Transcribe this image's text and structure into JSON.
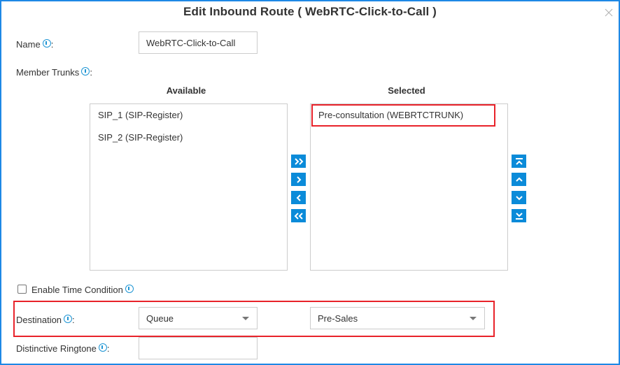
{
  "dialog": {
    "title": "Edit Inbound Route ( WebRTC-Click-to-Call )",
    "close_icon": "close-icon"
  },
  "form": {
    "name": {
      "label": "Name",
      "suffix": ":",
      "value": "WebRTC-Click-to-Call"
    },
    "member_trunks": {
      "label": "Member Trunks",
      "suffix": ":",
      "available_heading": "Available",
      "selected_heading": "Selected",
      "available": [
        "SIP_1 (SIP-Register)",
        "SIP_2 (SIP-Register)"
      ],
      "selected": [
        "Pre-consultation (WEBRTCTRUNK)"
      ],
      "transfer_buttons": [
        {
          "name": "move-all-right",
          "icon": "double-chevron-right-icon"
        },
        {
          "name": "move-right",
          "icon": "chevron-right-icon"
        },
        {
          "name": "move-left",
          "icon": "chevron-left-icon"
        },
        {
          "name": "move-all-left",
          "icon": "double-chevron-left-icon"
        }
      ],
      "order_buttons": [
        {
          "name": "move-top",
          "icon": "move-to-top-icon"
        },
        {
          "name": "move-up",
          "icon": "chevron-up-icon"
        },
        {
          "name": "move-down",
          "icon": "chevron-down-icon"
        },
        {
          "name": "move-bottom",
          "icon": "move-to-bottom-icon"
        }
      ]
    },
    "time_condition": {
      "label": "Enable Time Condition",
      "checked": false
    },
    "destination": {
      "label": "Destination",
      "suffix": ":",
      "type_value": "Queue",
      "target_value": "Pre-Sales"
    },
    "distinctive_ringtone": {
      "label": "Distinctive Ringtone",
      "suffix": ":",
      "value": ""
    }
  },
  "colors": {
    "accent": "#0b8bd9",
    "frame": "#1e88e5",
    "highlight": "#e8222a"
  }
}
